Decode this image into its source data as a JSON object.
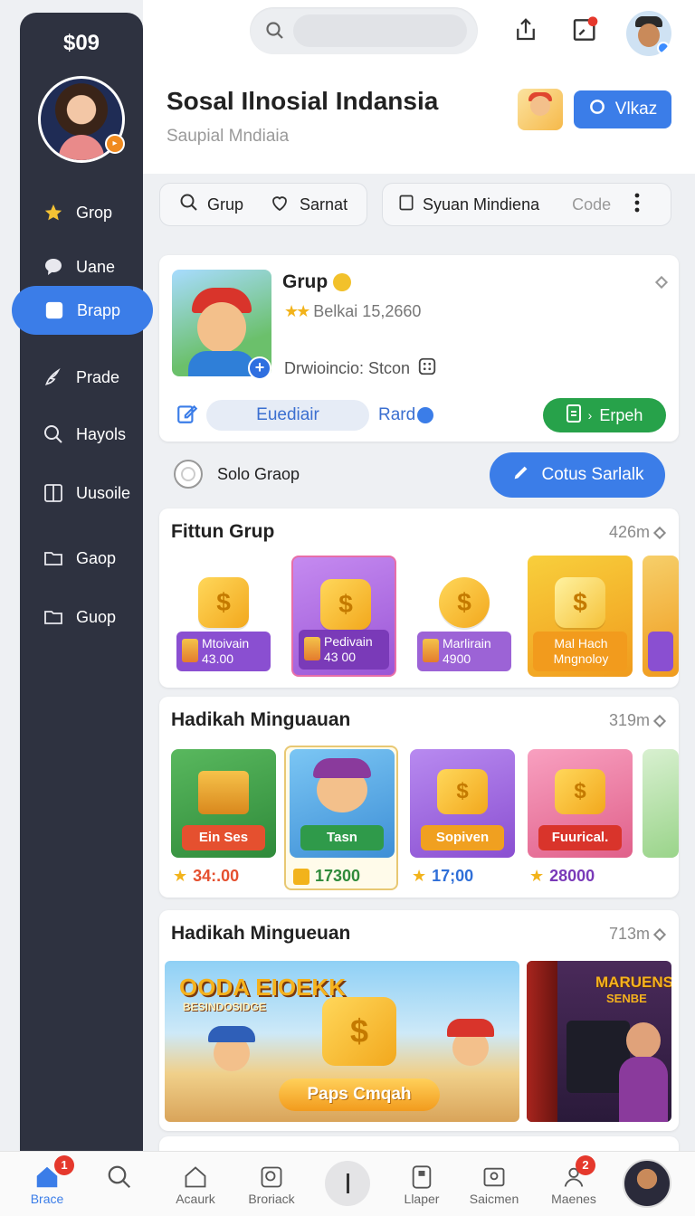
{
  "sidebar": {
    "balance": "$09",
    "items": [
      {
        "label": "Grop",
        "icon": "star-icon"
      },
      {
        "label": "Uane",
        "icon": "chat-bubble-icon"
      },
      {
        "label": "Brapp",
        "icon": "square-icon",
        "active": true
      },
      {
        "label": "Prade",
        "icon": "puzzle-icon"
      },
      {
        "label": "Hayols",
        "icon": "search-icon"
      },
      {
        "label": "Uusoile",
        "icon": "book-icon"
      },
      {
        "label": "Gaop",
        "icon": "folder-icon"
      },
      {
        "label": "Guop",
        "icon": "folder-icon"
      }
    ]
  },
  "header": {
    "title": "Sosal Ilnosial Indansia",
    "subtitle": "Saupial Mndiaia",
    "button_label": "Vlkaz"
  },
  "filters": {
    "grup": "Grup",
    "saved": "Sarnat",
    "sort": "Syuan Mindiena",
    "code": "Code"
  },
  "profile_card": {
    "name": "Grup",
    "rating_text": "Belkai 15,2660",
    "detail": "Drwioincio: Stcon",
    "tag": "Euediair",
    "link": "Rard",
    "action": "Erpeh"
  },
  "solo": {
    "label": "Solo Graop",
    "button": "Cotus Sarlalk"
  },
  "features": {
    "title": "Fittun Grup",
    "meta": "426m",
    "tiles": [
      {
        "name": "Mtoivain",
        "value": "43.00",
        "bg": "#ffffff",
        "label_color": "#8a4fd1"
      },
      {
        "name": "Pedivain",
        "value": "43 00",
        "bg": "#b76fe0",
        "label_color": "#7a3ab8"
      },
      {
        "name": "Marlirain",
        "value": "4900",
        "bg": "#ffffff",
        "label_color": "#9c63d6"
      },
      {
        "name": "Mal Hach",
        "value": "Mngnoloy",
        "bg": "#f4b226",
        "label_color": "#f29b1d"
      }
    ]
  },
  "weekly": {
    "title": "Hadikah Minguauan",
    "meta": "319m",
    "items": [
      {
        "tag": "Ein Ses",
        "price": "34:.00",
        "bg": "#3f9a46",
        "tag_color": "#e5502f",
        "price_color": "#e5502f"
      },
      {
        "tag": "Tasn",
        "price": "17300",
        "bg": "#4aa0e0",
        "tag_color": "#2f9a4a",
        "price_color": "#2f8a3a"
      },
      {
        "tag": "Sopiven",
        "price": "17;00",
        "bg": "#a66bdc",
        "tag_color": "#f0a020",
        "price_color": "#2f6fd8"
      },
      {
        "tag": "Fuurical.",
        "price": "28000",
        "bg": "#f07aa0",
        "tag_color": "#d9342b",
        "price_color": "#7a3ab8"
      }
    ]
  },
  "weekly2": {
    "title": "Hadikah Mingueuan",
    "meta": "713m",
    "banner_logo": "OODA EIOEKK",
    "banner_sub": "BESINDOSIDGE",
    "banner_button": "Paps Cmqah",
    "banner2_logo": "MARUENS",
    "banner2_sub": "SENBE"
  },
  "bottom_nav": [
    {
      "label": "Brace",
      "icon": "home-icon",
      "badge": "1",
      "active": true
    },
    {
      "label": "",
      "icon": "search-icon"
    },
    {
      "label": "Acaurk",
      "icon": "house-outline-icon"
    },
    {
      "label": "Broriack",
      "icon": "search-box-icon"
    },
    {
      "label": "",
      "icon": "center-icon"
    },
    {
      "label": "Llaper",
      "icon": "tablet-icon"
    },
    {
      "label": "Saicmen",
      "icon": "image-icon"
    },
    {
      "label": "Maenes",
      "icon": "user-icon",
      "badge": "2"
    },
    {
      "label": "",
      "icon": "avatar"
    }
  ],
  "colors": {
    "accent": "#3b7de8",
    "sidebar": "#2e3240",
    "success": "#27a24a"
  }
}
